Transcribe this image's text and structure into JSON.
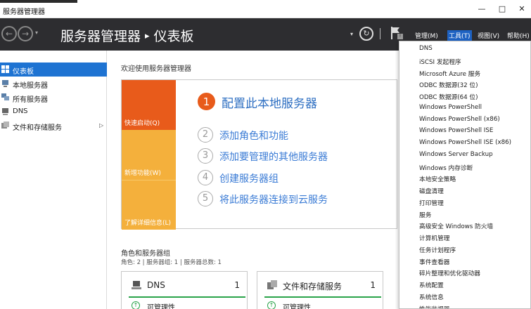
{
  "window": {
    "title": "服务器管理器",
    "min": "—",
    "max": "□",
    "close": "✕"
  },
  "header": {
    "breadcrumb_root": "服务器管理器",
    "breadcrumb_sep": "▸",
    "breadcrumb_page": "仪表板",
    "back": "←",
    "forward": "→",
    "nav_dropdown": "▾",
    "dropdown": "▾",
    "refresh": "↻",
    "flag_badge": "!",
    "menus": [
      "管理(M)",
      "工具(T)",
      "视图(V)",
      "帮助(H)"
    ]
  },
  "sidebar": {
    "items": [
      {
        "label": "仪表板",
        "icon": "dashboard-icon"
      },
      {
        "label": "本地服务器",
        "icon": "server-icon"
      },
      {
        "label": "所有服务器",
        "icon": "servers-icon"
      },
      {
        "label": "DNS",
        "icon": "dns-icon"
      },
      {
        "label": "文件和存储服务",
        "icon": "storage-icon",
        "arrow": "▷"
      }
    ]
  },
  "main": {
    "welcome": "欢迎使用服务器管理器",
    "tiles": [
      "快速启动(Q)",
      "新增功能(W)",
      "了解详细信息(L)"
    ],
    "steps": [
      {
        "num": "1",
        "text": "配置此本地服务器"
      },
      {
        "num": "2",
        "text": "添加角色和功能"
      },
      {
        "num": "3",
        "text": "添加要管理的其他服务器"
      },
      {
        "num": "4",
        "text": "创建服务器组"
      },
      {
        "num": "5",
        "text": "将此服务器连接到云服务"
      }
    ],
    "roles_title": "角色和服务器组",
    "roles_sub": "角色: 2 | 服务器组: 1 | 服务器总数: 1",
    "cards": [
      {
        "name": "DNS",
        "count": "1",
        "status": "可管理性",
        "status_icon": "↑"
      },
      {
        "name": "文件和存储服务",
        "count": "1",
        "status": "可管理性",
        "status_icon": "↑"
      }
    ]
  },
  "tools_menu": {
    "items": [
      "DNS",
      "iSCSI 发起程序",
      "Microsoft Azure 服务",
      "ODBC 数据源(32 位)",
      "ODBC 数据源(64 位)",
      "Windows PowerShell",
      "Windows PowerShell (x86)",
      "Windows PowerShell ISE",
      "Windows PowerShell ISE (x86)",
      "Windows Server Backup",
      "Windows 内存诊断",
      "本地安全策略",
      "磁盘清理",
      "打印管理",
      "服务",
      "高级安全 Windows 防火墙",
      "计算机管理",
      "任务计划程序",
      "事件查看器",
      "碎片整理和优化驱动器",
      "系统配置",
      "系统信息",
      "性能监视器"
    ]
  },
  "colors": {
    "accent": "#1e73d2",
    "header": "#2d2d30",
    "orange": "#e85b1b",
    "amber": "#f4b03c",
    "ok": "#2aa34a"
  }
}
